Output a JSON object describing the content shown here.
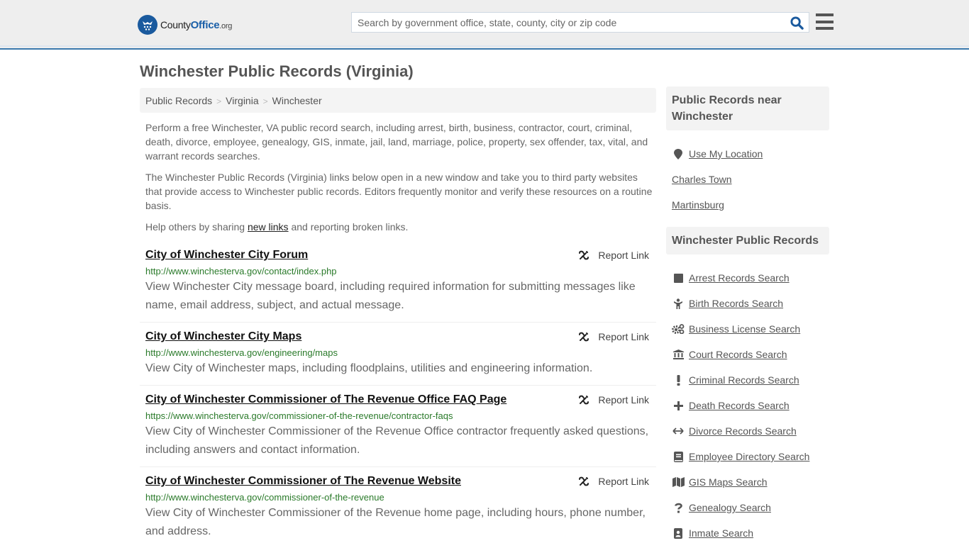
{
  "header": {
    "logo": {
      "prefix": "County",
      "bold": "Office",
      "tld": ".org"
    },
    "search": {
      "placeholder": "Search by government office, state, county, city or zip code",
      "value": ""
    },
    "search_icon": "search-icon",
    "menu_icon": "hamburger-menu-icon"
  },
  "colors": {
    "brand_blue": "#1a5a9e",
    "header_border": "#3b79ad",
    "url_green": "#2a7a2a"
  },
  "page": {
    "title": "Winchester Public Records (Virginia)",
    "breadcrumb": [
      {
        "label": "Public Records"
      },
      {
        "label": "Virginia"
      },
      {
        "label": "Winchester"
      }
    ],
    "breadcrumb_sep": ">",
    "intro": {
      "p1": "Perform a free Winchester, VA public record search, including arrest, birth, business, contractor, court, criminal, death, divorce, employee, genealogy, GIS, inmate, jail, land, marriage, police, property, sex offender, tax, vital, and warrant records searches.",
      "p2": "The Winchester Public Records (Virginia) links below open in a new window and take you to third party websites that provide access to Winchester public records. Editors frequently monitor and verify these resources on a routine basis.",
      "p3_before": "Help others by sharing ",
      "p3_link": "new links",
      "p3_after": " and reporting broken links."
    }
  },
  "results": [
    {
      "title": "City of Winchester City Forum",
      "url": "http://www.winchesterva.gov/contact/index.php",
      "description": "View Winchester City message board, including required information for submitting messages like name, email address, subject, and actual message.",
      "report_label": "Report Link"
    },
    {
      "title": "City of Winchester City Maps",
      "url": "http://www.winchesterva.gov/engineering/maps",
      "description": "View City of Winchester maps, including floodplains, utilities and engineering information.",
      "report_label": "Report Link"
    },
    {
      "title": "City of Winchester Commissioner of The Revenue Office FAQ Page",
      "url": "https://www.winchesterva.gov/commissioner-of-the-revenue/contractor-faqs",
      "description": "View City of Winchester Commissioner of the Revenue Office contractor frequently asked questions, including answers and contact information.",
      "report_label": "Report Link"
    },
    {
      "title": "City of Winchester Commissioner of The Revenue Website",
      "url": "http://www.winchesterva.gov/commissioner-of-the-revenue",
      "description": "View City of Winchester Commissioner of the Revenue home page, including hours, phone number, and address.",
      "report_label": "Report Link"
    }
  ],
  "sidebar": {
    "near": {
      "heading": "Public Records near Winchester",
      "items": [
        {
          "label": "Use My Location",
          "icon": "map-pin-icon"
        },
        {
          "label": "Charles Town"
        },
        {
          "label": "Martinsburg"
        }
      ]
    },
    "records": {
      "heading": "Winchester Public Records",
      "items": [
        {
          "label": "Arrest Records Search",
          "icon": "square-icon"
        },
        {
          "label": "Birth Records Search",
          "icon": "child-icon"
        },
        {
          "label": "Business License Search",
          "icon": "gears-icon"
        },
        {
          "label": "Court Records Search",
          "icon": "courthouse-icon"
        },
        {
          "label": "Criminal Records Search",
          "icon": "exclamation-icon"
        },
        {
          "label": "Death Records Search",
          "icon": "cross-icon"
        },
        {
          "label": "Divorce Records Search",
          "icon": "arrows-horizontal-icon"
        },
        {
          "label": "Employee Directory Search",
          "icon": "book-icon"
        },
        {
          "label": "GIS Maps Search",
          "icon": "map-icon"
        },
        {
          "label": "Genealogy Search",
          "icon": "question-icon"
        },
        {
          "label": "Inmate Search",
          "icon": "id-badge-icon"
        }
      ]
    }
  }
}
